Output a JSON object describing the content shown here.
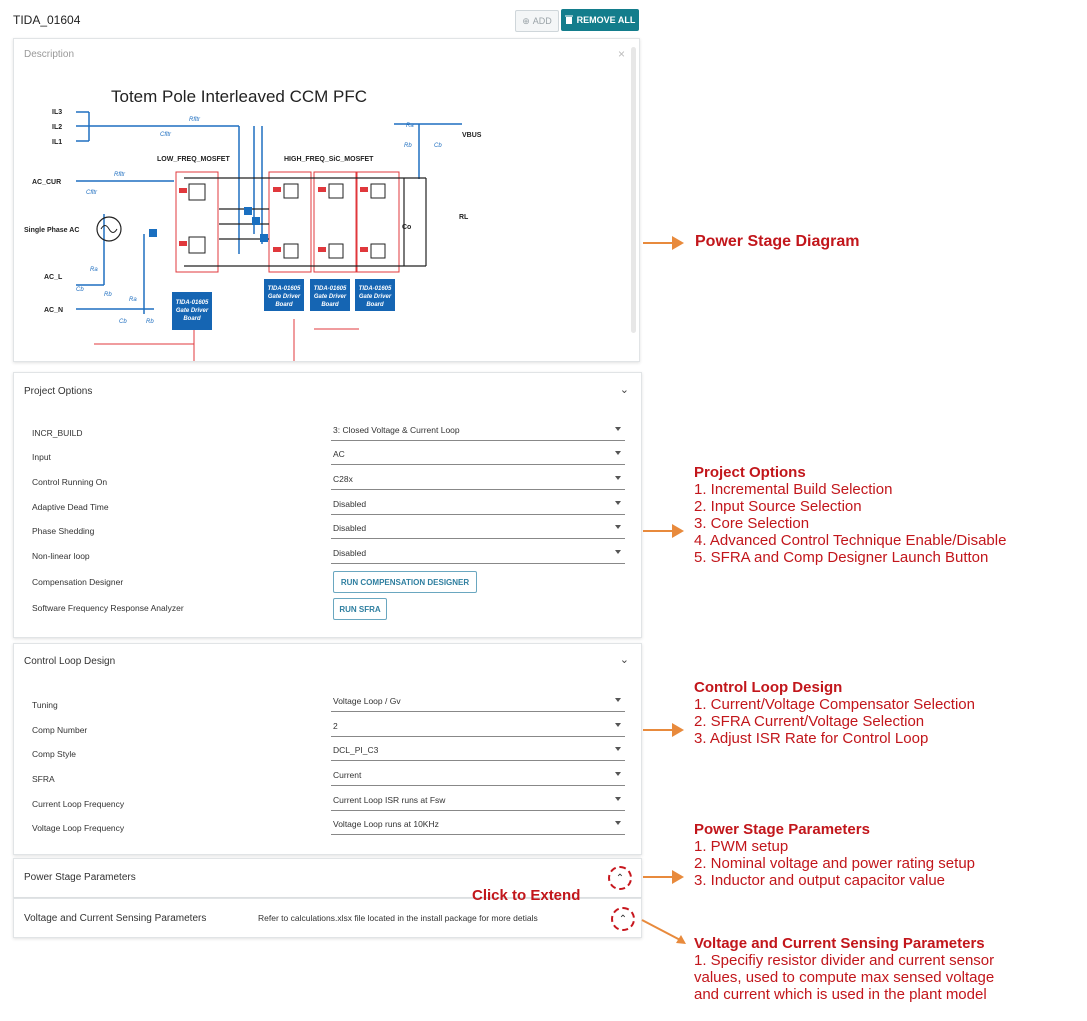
{
  "header": {
    "app_title": "TIDA_01604",
    "add_label": "ADD",
    "remove_all_label": "REMOVE ALL"
  },
  "description": {
    "title": "Description",
    "close_symbol": "×",
    "diagram": {
      "title": "Totem Pole Interleaved CCM PFC",
      "labels": [
        "IL3",
        "IL2",
        "IL1",
        "AC_CUR",
        "Single Phase AC",
        "AC_L",
        "AC_N",
        "VBUS",
        "LOW_FREQ_MOSFET",
        "HIGH_FREQ_SiC_MOSFET",
        "Rfltr",
        "Cfltr",
        "Ra",
        "Rb",
        "Cb",
        "RL",
        "Co"
      ],
      "driver_board_label": [
        "TIDA-01605",
        "Gate Driver",
        "Board"
      ]
    }
  },
  "project_options": {
    "title": "Project Options",
    "rows": [
      {
        "label": "INCR_BUILD",
        "value": "3: Closed Voltage & Current Loop"
      },
      {
        "label": "Input",
        "value": "AC"
      },
      {
        "label": "Control Running On",
        "value": "C28x"
      },
      {
        "label": "Adaptive Dead Time",
        "value": "Disabled"
      },
      {
        "label": "Phase Shedding",
        "value": "Disabled"
      },
      {
        "label": "Non-linear loop",
        "value": "Disabled"
      }
    ],
    "compensation_label": "Compensation Designer",
    "compensation_button": "RUN COMPENSATION DESIGNER",
    "sfra_label": "Software Frequency Response Analyzer",
    "sfra_button": "RUN SFRA"
  },
  "control_loop": {
    "title": "Control Loop Design",
    "rows": [
      {
        "label": "Tuning",
        "value": "Voltage Loop / Gv"
      },
      {
        "label": "Comp Number",
        "value": "2"
      },
      {
        "label": "Comp Style",
        "value": "DCL_PI_C3"
      },
      {
        "label": "SFRA",
        "value": "Current"
      },
      {
        "label": "Current Loop Frequency",
        "value": "Current Loop ISR runs at Fsw"
      },
      {
        "label": "Voltage Loop Frequency",
        "value": "Voltage Loop runs at 10KHz"
      }
    ]
  },
  "power_stage": {
    "title": "Power Stage Parameters"
  },
  "sensing": {
    "title": "Voltage and Current Sensing Parameters",
    "note": "Refer to calculations.xlsx file located in the install package for more detials"
  },
  "annotations": {
    "power_stage_diagram": "Power Stage Diagram",
    "project_options": {
      "head": "Project Options",
      "lines": [
        "1. Incremental Build Selection",
        "2. Input Source Selection",
        "3. Core Selection",
        "4. Advanced Control Technique Enable/Disable",
        "5. SFRA and Comp Designer Launch Button"
      ]
    },
    "control_loop": {
      "head": "Control Loop Design",
      "lines": [
        "1. Current/Voltage Compensator Selection",
        "2. SFRA Current/Voltage Selection",
        "3. Adjust ISR Rate for Control Loop"
      ]
    },
    "power_stage": {
      "head": "Power Stage Parameters",
      "lines": [
        "1. PWM setup",
        "2. Nominal voltage and power rating setup",
        "3. Inductor and output capacitor value"
      ]
    },
    "click_to_extend": "Click to Extend",
    "sensing": {
      "head": "Voltage and Current Sensing Parameters",
      "lines": [
        "1. Specifiy resistor divider and current sensor",
        "values, used to compute max sensed voltage",
        "and current which is used in the plant model"
      ]
    }
  },
  "colors": {
    "accent": "#137d8c",
    "annotation": "#c2161b",
    "arrow": "#e88a3c",
    "wire_blue": "#1f6fc0",
    "wire_red": "#e0383c"
  }
}
